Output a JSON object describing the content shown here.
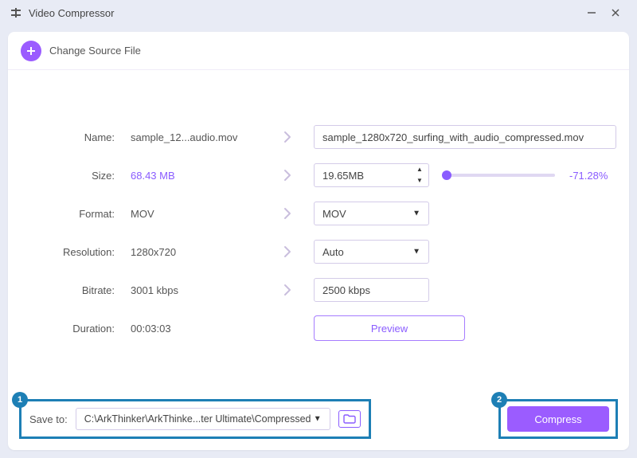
{
  "window": {
    "title": "Video Compressor"
  },
  "header": {
    "change_source_label": "Change Source File"
  },
  "fields": {
    "name": {
      "label": "Name:",
      "current": "sample_12...audio.mov",
      "output": "sample_1280x720_surfing_with_audio_compressed.mov"
    },
    "size": {
      "label": "Size:",
      "current": "68.43 MB",
      "output": "19.65MB",
      "reduction": "-71.28%"
    },
    "format": {
      "label": "Format:",
      "current": "MOV",
      "output": "MOV"
    },
    "resolution": {
      "label": "Resolution:",
      "current": "1280x720",
      "output": "Auto"
    },
    "bitrate": {
      "label": "Bitrate:",
      "current": "3001 kbps",
      "output": "2500 kbps"
    },
    "duration": {
      "label": "Duration:",
      "current": "00:03:03"
    }
  },
  "preview_label": "Preview",
  "saveto": {
    "label": "Save to:",
    "path": "C:\\ArkThinker\\ArkThinke...ter Ultimate\\Compressed"
  },
  "compress_label": "Compress",
  "annotations": {
    "step1": "1",
    "step2": "2"
  }
}
